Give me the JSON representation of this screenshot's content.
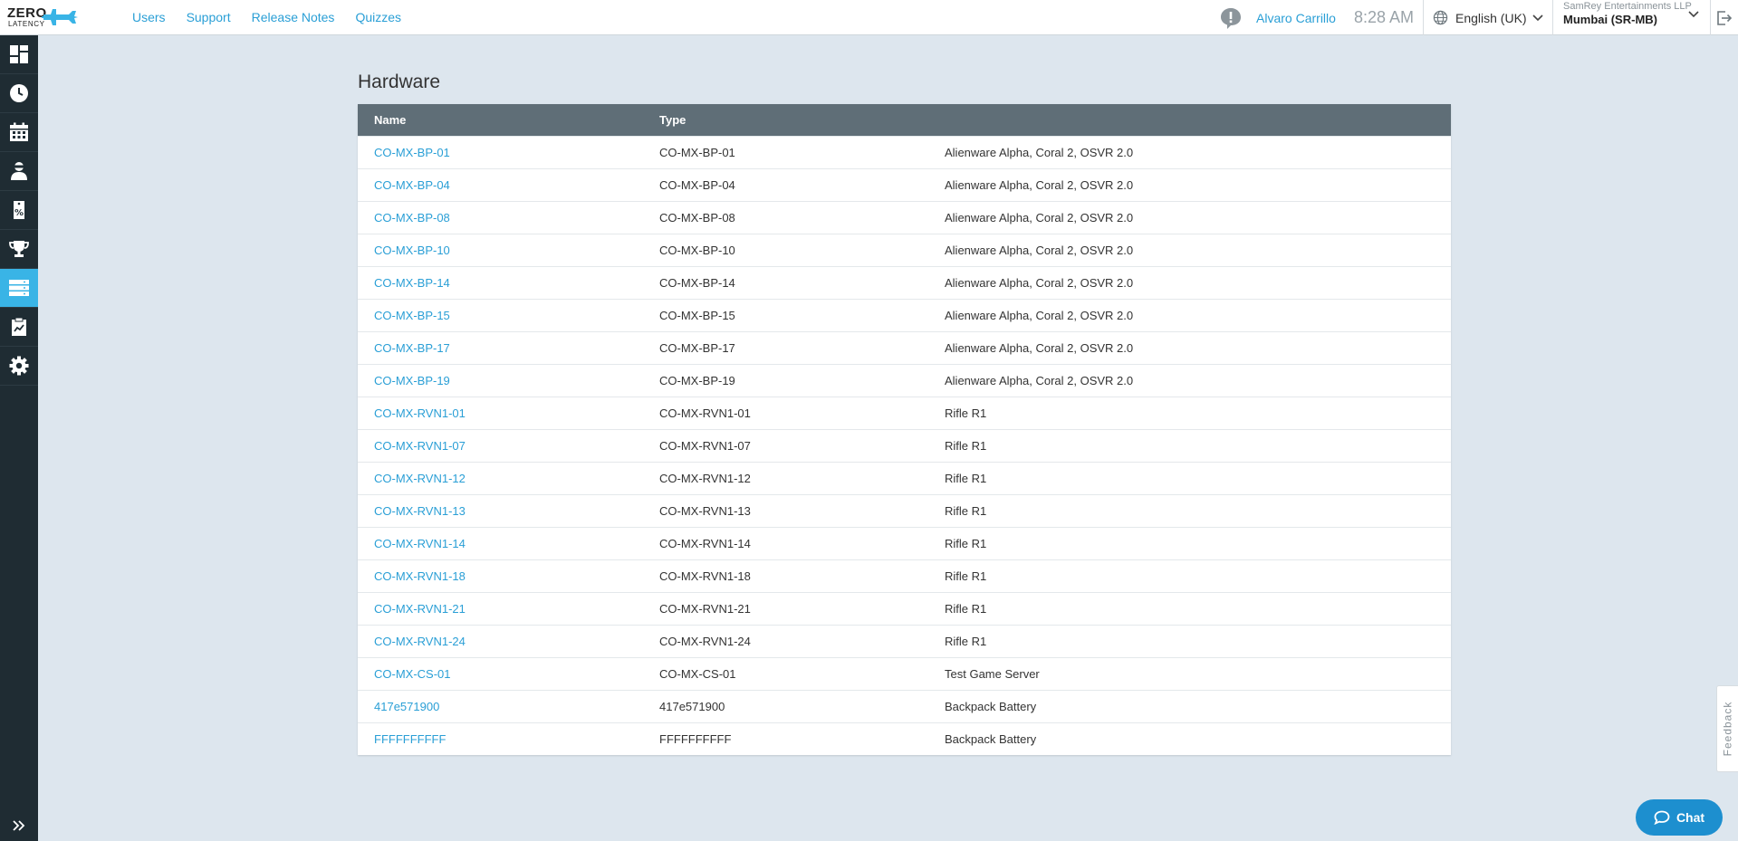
{
  "brand": {
    "line1": "ZERO",
    "line2": "LATENCY"
  },
  "nav": [
    {
      "label": "Users"
    },
    {
      "label": "Support"
    },
    {
      "label": "Release Notes"
    },
    {
      "label": "Quizzes"
    }
  ],
  "header": {
    "user": "Alvaro Carrillo",
    "time": "8:28 AM",
    "language": "English (UK)",
    "company": "SamRey Entertainments LLP",
    "site": "Mumbai (SR-MB)"
  },
  "sidebar": {
    "items": [
      {
        "icon": "dashboard-icon"
      },
      {
        "icon": "clock-icon"
      },
      {
        "icon": "calendar-icon"
      },
      {
        "icon": "player-icon"
      },
      {
        "icon": "voucher-icon"
      },
      {
        "icon": "trophy-icon"
      },
      {
        "icon": "hardware-icon",
        "active": true
      },
      {
        "icon": "report-icon"
      },
      {
        "icon": "settings-icon"
      }
    ],
    "expand_icon": "expand-icon"
  },
  "page": {
    "title": "Hardware"
  },
  "table": {
    "headers": [
      "Name",
      "Type",
      ""
    ],
    "rows": [
      [
        "CO-MX-BP-01",
        "CO-MX-BP-01",
        "Alienware Alpha, Coral 2, OSVR 2.0"
      ],
      [
        "CO-MX-BP-04",
        "CO-MX-BP-04",
        "Alienware Alpha, Coral 2, OSVR 2.0"
      ],
      [
        "CO-MX-BP-08",
        "CO-MX-BP-08",
        "Alienware Alpha, Coral 2, OSVR 2.0"
      ],
      [
        "CO-MX-BP-10",
        "CO-MX-BP-10",
        "Alienware Alpha, Coral 2, OSVR 2.0"
      ],
      [
        "CO-MX-BP-14",
        "CO-MX-BP-14",
        "Alienware Alpha, Coral 2, OSVR 2.0"
      ],
      [
        "CO-MX-BP-15",
        "CO-MX-BP-15",
        "Alienware Alpha, Coral 2, OSVR 2.0"
      ],
      [
        "CO-MX-BP-17",
        "CO-MX-BP-17",
        "Alienware Alpha, Coral 2, OSVR 2.0"
      ],
      [
        "CO-MX-BP-19",
        "CO-MX-BP-19",
        "Alienware Alpha, Coral 2, OSVR 2.0"
      ],
      [
        "CO-MX-RVN1-01",
        "CO-MX-RVN1-01",
        "Rifle R1"
      ],
      [
        "CO-MX-RVN1-07",
        "CO-MX-RVN1-07",
        "Rifle R1"
      ],
      [
        "CO-MX-RVN1-12",
        "CO-MX-RVN1-12",
        "Rifle R1"
      ],
      [
        "CO-MX-RVN1-13",
        "CO-MX-RVN1-13",
        "Rifle R1"
      ],
      [
        "CO-MX-RVN1-14",
        "CO-MX-RVN1-14",
        "Rifle R1"
      ],
      [
        "CO-MX-RVN1-18",
        "CO-MX-RVN1-18",
        "Rifle R1"
      ],
      [
        "CO-MX-RVN1-21",
        "CO-MX-RVN1-21",
        "Rifle R1"
      ],
      [
        "CO-MX-RVN1-24",
        "CO-MX-RVN1-24",
        "Rifle R1"
      ],
      [
        "CO-MX-CS-01",
        "CO-MX-CS-01",
        "Test Game Server"
      ],
      [
        "417e571900",
        "417e571900",
        "Backpack Battery"
      ],
      [
        "FFFFFFFFFF",
        "FFFFFFFFFF",
        "Backpack Battery"
      ]
    ]
  },
  "feedback": {
    "label": "Feedback"
  },
  "chat": {
    "label": "Chat"
  },
  "colors": {
    "accent": "#2a9fd6",
    "sidebar_bg": "#1f2c33",
    "sidebar_active": "#39b4e6",
    "table_header": "#5f6e77",
    "page_bg": "#dde6ee",
    "chat_bg": "#1d8fcf"
  }
}
